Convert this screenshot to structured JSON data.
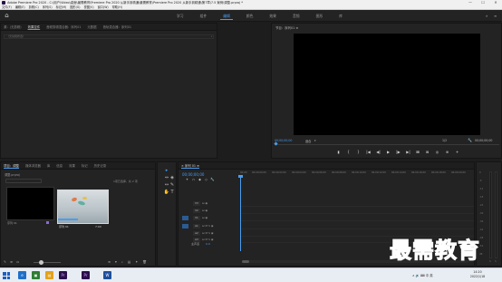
{
  "titlebar": {
    "title": "Adobe Premiere Pro 2020 - C:\\用户\\Video\\桌面\\最需教育\\Premiere Pro 2020 从新手到精通\\最需教育\\Premiere Pro 2020 从新手到精通\\第7章\\7.5 案例\\调整.prproj *",
    "controls": [
      "—",
      "☐",
      "✕"
    ]
  },
  "menubar": {
    "items": [
      "文件(F)",
      "编辑(E)",
      "剪辑(C)",
      "序列(S)",
      "标记(M)",
      "图形(G)",
      "视图(V)",
      "窗口(W)",
      "帮助(H)"
    ]
  },
  "workspace": {
    "tabs": [
      "学习",
      "组件",
      "编辑",
      "颜色",
      "效果",
      "音频",
      "图形",
      "库"
    ],
    "active_index": 2,
    "more": "»",
    "menu": "≡"
  },
  "source": {
    "tabs": [
      "源：(无剪辑)",
      "效果控件",
      "音频剪辑混合器：序列01",
      "元数据",
      "音轨混合器：序列01"
    ],
    "active_index": 1,
    "sub_label": "（无剪辑所选）",
    "chevron": "›"
  },
  "program": {
    "title": "节目：序列01 ≡",
    "timecode_left": "00;00;00;00",
    "fit": "适合",
    "fit_chevron": "▾",
    "ratio": "1/2",
    "wrench": "🔧",
    "timecode_right": "00;00;00;00",
    "transport": [
      "▮",
      "{",
      "}",
      "|◀",
      "◀|",
      "▶",
      "|▶",
      "▶|",
      "⊞"
    ],
    "right_buttons": [
      "⊟",
      "⊠",
      "◎",
      "⊕",
      "+"
    ]
  },
  "project": {
    "tabs": [
      "项目：调整",
      "媒体浏览器",
      "库",
      "信息",
      "效果",
      "标记",
      "历史记录"
    ],
    "active_index": 0,
    "name": "调整.prproj",
    "item_count": "1项已选择，共 2 项",
    "items": [
      {
        "label": "序列 01",
        "duration": ""
      },
      {
        "label": "序列 01",
        "duration": "7:00"
      }
    ],
    "bottom_left": [
      "✎",
      "≡",
      "▭",
      "◎"
    ],
    "bottom_right": [
      "≡",
      "▾",
      "⌕",
      "▤",
      "✦",
      "🗑"
    ]
  },
  "tools": {
    "items": [
      "▸",
      "⇔",
      "◈",
      "↔",
      "✎",
      "✋",
      "T"
    ],
    "active_index": 0
  },
  "timeline": {
    "tab": "× 序列 01 ≡",
    "timecode": "00;00;00;00",
    "tools": [
      "✦",
      "∩",
      "◆",
      "◇",
      "🔧"
    ],
    "ticks": [
      "00;00",
      "00;00;00;00",
      "00;00;02;00",
      "00;00;04;00",
      "00;00;06;00",
      "00;00;08;00",
      "00;00;10;00",
      "00;00;12;00",
      "00;00;14;00",
      "00;00;16;00",
      "00;00;18;00",
      "00;00;20;00"
    ],
    "video_tracks": [
      {
        "name": "V3",
        "icons": "⊟ ◉"
      },
      {
        "name": "V2",
        "icons": "⊟ ◉"
      },
      {
        "name": "V1",
        "icons": "⊟ ◉"
      }
    ],
    "audio_tracks": [
      {
        "name": "A1",
        "icons": "⊟ M S ◉"
      },
      {
        "name": "A2",
        "icons": "⊟ M S ◉"
      },
      {
        "name": "A3",
        "icons": "⊟ M S ◉"
      }
    ],
    "master_label": "主声道",
    "master_value": "0.0"
  },
  "meters": {
    "scale": [
      "0",
      "-6",
      "-12",
      "-18",
      "-24",
      "-30",
      "-36",
      "-42",
      "-48",
      "-54",
      "dB"
    ],
    "footer": [
      "S",
      "S"
    ]
  },
  "taskbar": {
    "apps": [
      "e",
      "▣",
      "▤",
      "Pr",
      "Pr",
      "W"
    ],
    "sys": "∧ 🔊 ⌨ 中 英",
    "time": "14:20",
    "date": "2022/1/18"
  },
  "watermark": "最需教育",
  "colors": {
    "accent": "#4a9cf0",
    "panel": "#232323",
    "taskbar": "#e8edf3"
  }
}
